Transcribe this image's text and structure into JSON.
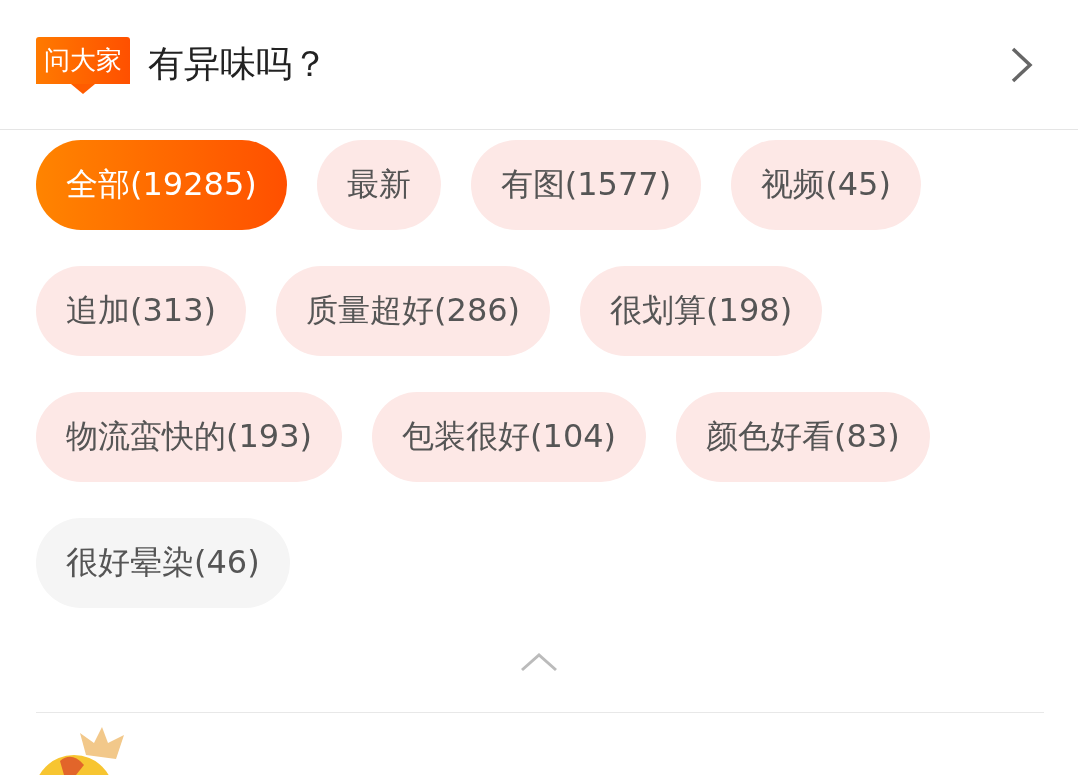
{
  "header": {
    "badge": "问大家",
    "question": "有异味吗？"
  },
  "tags": [
    {
      "label": "全部(19285)",
      "kind": "positive",
      "selected": true
    },
    {
      "label": "最新",
      "kind": "positive",
      "selected": false
    },
    {
      "label": "有图(1577)",
      "kind": "positive",
      "selected": false
    },
    {
      "label": "视频(45)",
      "kind": "positive",
      "selected": false
    },
    {
      "label": "追加(313)",
      "kind": "positive",
      "selected": false
    },
    {
      "label": "质量超好(286)",
      "kind": "positive",
      "selected": false
    },
    {
      "label": "很划算(198)",
      "kind": "positive",
      "selected": false
    },
    {
      "label": "物流蛮快的(193)",
      "kind": "positive",
      "selected": false
    },
    {
      "label": "包装很好(104)",
      "kind": "positive",
      "selected": false
    },
    {
      "label": "颜色好看(83)",
      "kind": "positive",
      "selected": false
    },
    {
      "label": "很好晕染(46)",
      "kind": "neutral",
      "selected": false
    }
  ],
  "collapse": {
    "expanded": true
  }
}
